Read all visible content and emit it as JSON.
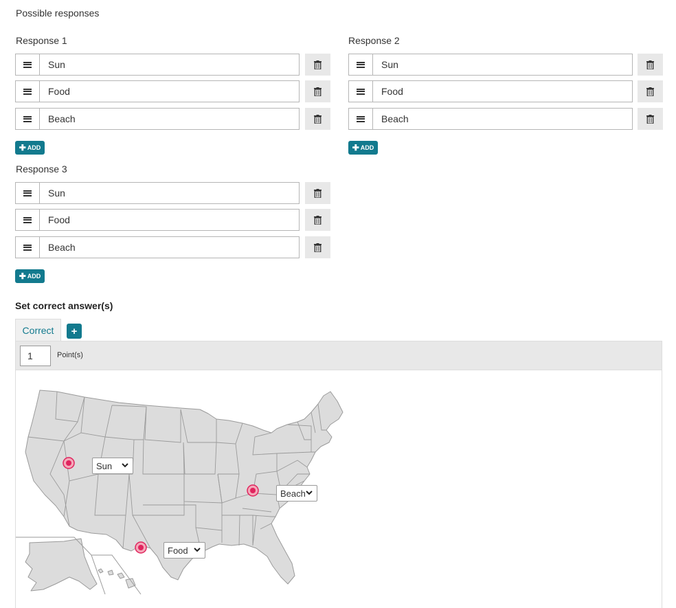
{
  "title": "Possible responses",
  "groups": [
    {
      "label": "Response 1",
      "items": [
        "Sun",
        "Food",
        "Beach"
      ],
      "add_label": "ADD"
    },
    {
      "label": "Response 2",
      "items": [
        "Sun",
        "Food",
        "Beach"
      ],
      "add_label": "ADD"
    },
    {
      "label": "Response 3",
      "items": [
        "Sun",
        "Food",
        "Beach"
      ],
      "add_label": "ADD"
    }
  ],
  "correct_section": {
    "title": "Set correct answer(s)",
    "tab_label": "Correct",
    "add_tab_icon": "plus-icon",
    "points_value": "1",
    "points_label": "Point(s)"
  },
  "map": {
    "region": "United States",
    "marker_color": "#e0245e",
    "dropdowns": [
      {
        "name": "response-1",
        "value": "Sun"
      },
      {
        "name": "response-2",
        "value": "Beach"
      },
      {
        "name": "response-3",
        "value": "Food"
      }
    ]
  },
  "colors": {
    "accent": "#127a8e",
    "map_fill": "#dcdcdc",
    "map_stroke": "#9a9a9a"
  }
}
